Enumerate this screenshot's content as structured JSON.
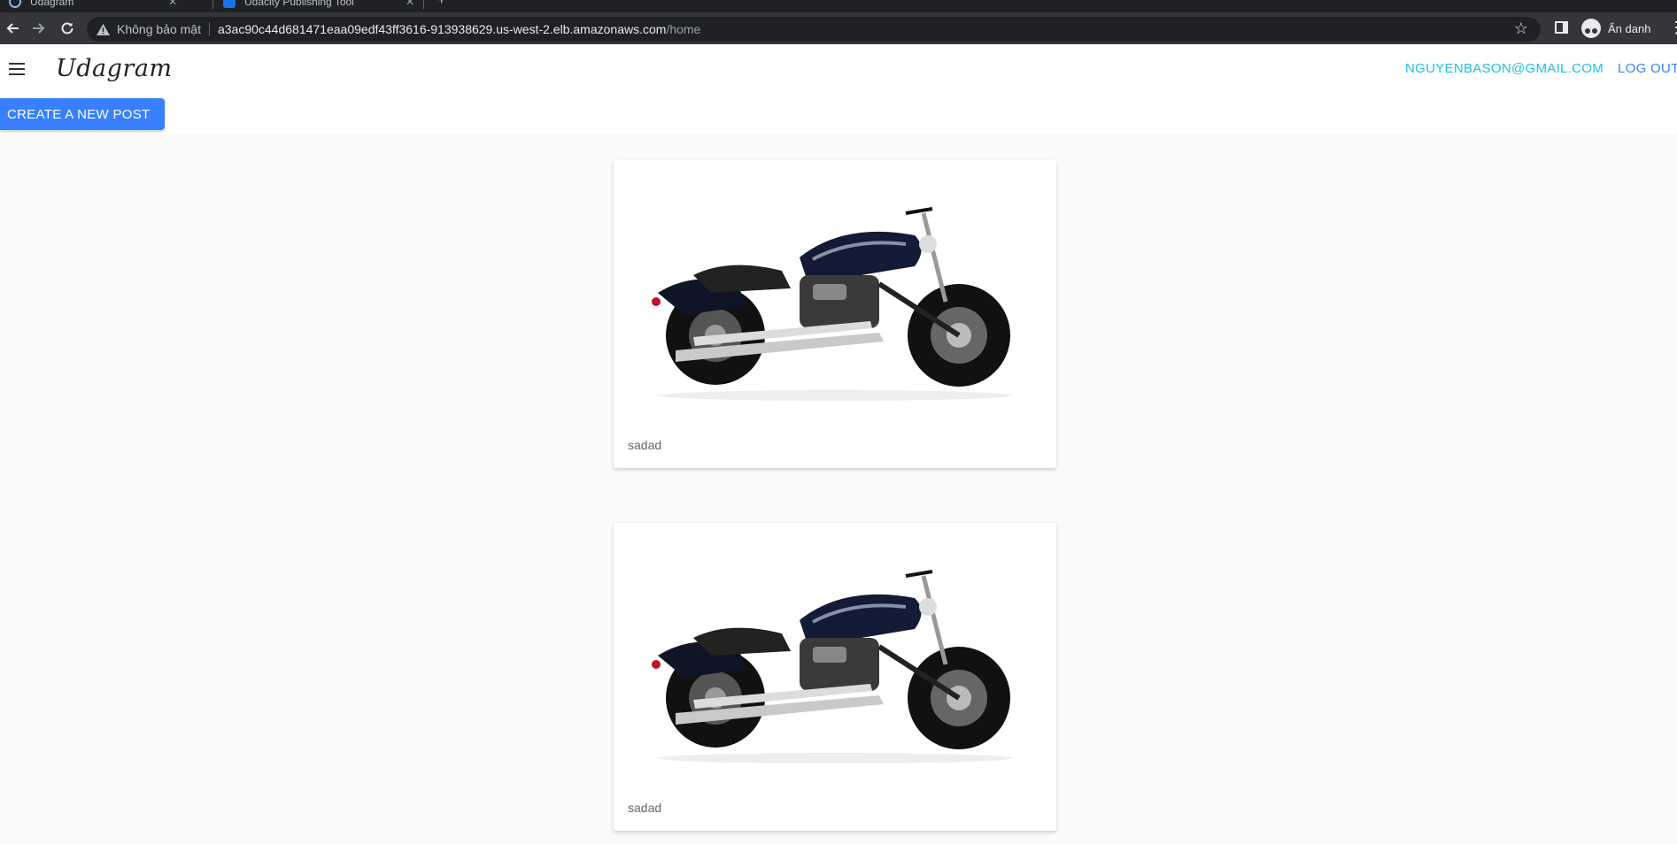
{
  "browser": {
    "tabs": [
      {
        "title": "Udagram"
      },
      {
        "title": "Udacity Publishing Tool"
      }
    ],
    "new_tab": "+",
    "security_label": "Không bảo mật",
    "url_host": "a3ac90c44d681471eaa09edf43ff3616-913938629.us-west-2.elb.amazonaws.com",
    "url_path": "/home",
    "incognito_label": "Ẩn danh"
  },
  "header": {
    "logo": "Udagram",
    "user_email": "NGUYENBASON@GMAIL.COM",
    "logout": "LOG OUT"
  },
  "toolbar": {
    "create_post": "CREATE A NEW POST"
  },
  "feed": {
    "posts": [
      {
        "caption": "sadad",
        "image": "motorcycle-image"
      },
      {
        "caption": "sadad",
        "image": "motorcycle-image"
      }
    ]
  },
  "colors": {
    "accent": "#3880ff",
    "user_link": "#1ec1e8",
    "background": "#fafafa",
    "chrome_dark": "#35363a"
  }
}
